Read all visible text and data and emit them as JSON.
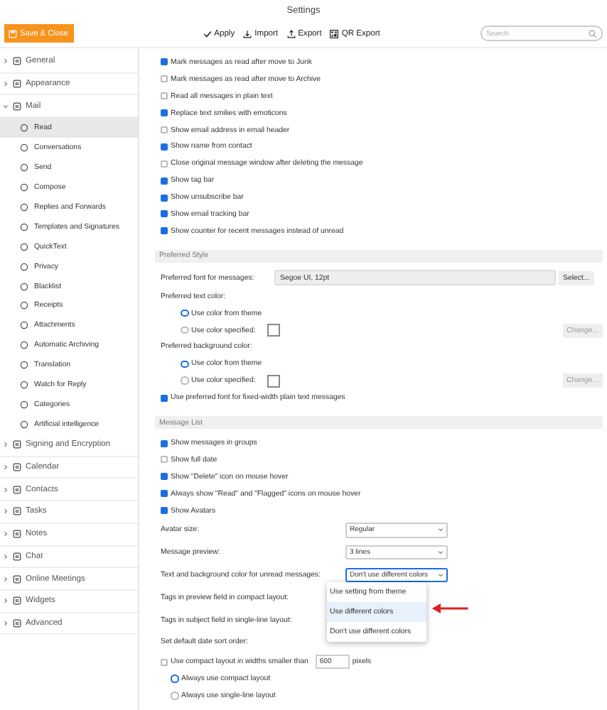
{
  "window": {
    "title": "Settings"
  },
  "toolbar": {
    "save": "Save & Close",
    "actions": [
      {
        "label": "Apply",
        "kind": "check"
      },
      {
        "label": "Import",
        "kind": "import"
      },
      {
        "label": "Export",
        "kind": "export"
      },
      {
        "label": "QR Export",
        "kind": "qr"
      }
    ],
    "search": {
      "placeholder": "Search"
    }
  },
  "sidebar": {
    "items": [
      {
        "label": "General",
        "expanded": false
      },
      {
        "label": "Appearance",
        "expanded": false
      },
      {
        "label": "Mail",
        "expanded": true,
        "children": [
          {
            "label": "Read",
            "selected": true
          },
          {
            "label": "Conversations",
            "selected": false
          },
          {
            "label": "Send",
            "selected": false
          },
          {
            "label": "Compose",
            "selected": false
          },
          {
            "label": "Replies and Forwards",
            "selected": false
          },
          {
            "label": "Templates and Signatures",
            "selected": false
          },
          {
            "label": "QuickText",
            "selected": false
          },
          {
            "label": "Privacy",
            "selected": false
          },
          {
            "label": "Blacklist",
            "selected": false
          },
          {
            "label": "Receipts",
            "selected": false
          },
          {
            "label": "Attachments",
            "selected": false
          },
          {
            "label": "Automatic Archiving",
            "selected": false
          },
          {
            "label": "Translation",
            "selected": false
          },
          {
            "label": "Watch for Reply",
            "selected": false
          },
          {
            "label": "Categories",
            "selected": false
          },
          {
            "label": "Artificial intelligence",
            "selected": false
          }
        ]
      },
      {
        "label": "Signing and Encryption",
        "expanded": false
      },
      {
        "label": "Calendar",
        "expanded": false
      },
      {
        "label": "Contacts",
        "expanded": false
      },
      {
        "label": "Tasks",
        "expanded": false
      },
      {
        "label": "Notes",
        "expanded": false
      },
      {
        "label": "Chat",
        "expanded": false
      },
      {
        "label": "Online Meetings",
        "expanded": false
      },
      {
        "label": "Widgets",
        "expanded": false
      },
      {
        "label": "Advanced",
        "expanded": false
      }
    ]
  },
  "read_options": [
    {
      "label": "Mark messages as read after move to Junk",
      "checked": true
    },
    {
      "label": "Mark messages as read after move to Archive",
      "checked": false
    },
    {
      "label": "Read all messages in plain text",
      "checked": false
    },
    {
      "label": "Replace text smilies with emoticons",
      "checked": true
    },
    {
      "label": "Show email address in email header",
      "checked": false
    },
    {
      "label": "Show name from contact",
      "checked": true
    },
    {
      "label": "Close original message window after deleting the message",
      "checked": false
    },
    {
      "label": "Show tag bar",
      "checked": true
    },
    {
      "label": "Show unsubscribe bar",
      "checked": true
    },
    {
      "label": "Show email tracking bar",
      "checked": true
    },
    {
      "label": "Show counter for recent messages instead of unread",
      "checked": true
    }
  ],
  "preferred_style": {
    "title": "Preferred Style",
    "font_label": "Preferred font for messages:",
    "font_value": "Segoe UI, 12pt",
    "select_button": "Select...",
    "text_color": {
      "label": "Preferred text color:",
      "options": [
        {
          "label": "Use color from theme",
          "selected": true
        },
        {
          "label": "Use color specified:",
          "selected": false
        }
      ],
      "change_button": "Change..."
    },
    "background_color": {
      "label": "Preferred background color:",
      "options": [
        {
          "label": "Use color from theme",
          "selected": true
        },
        {
          "label": "Use color specified:",
          "selected": false
        }
      ],
      "change_button": "Change..."
    },
    "fixed_width": {
      "label": "Use preferred font for fixed-width plain text messages",
      "checked": true
    }
  },
  "message_list": {
    "title": "Message List",
    "options": [
      {
        "label": "Show messages in groups",
        "checked": true
      },
      {
        "label": "Show full date",
        "checked": false
      },
      {
        "label": "Show \"Delete\" icon on mouse hover",
        "checked": true
      },
      {
        "label": "Always show \"Read\" and \"Flagged\" icons on mouse hover",
        "checked": true
      },
      {
        "label": "Show Avatars",
        "checked": true
      }
    ],
    "selects": [
      {
        "label": "Avatar size:",
        "value": "Regular",
        "open": false
      },
      {
        "label": "Message preview:",
        "value": "3 lines",
        "open": false
      },
      {
        "label": "Text and background color for unread messages:",
        "value": "Don't use different colors",
        "open": true
      },
      {
        "label": "Tags in preview field in compact layout:"
      },
      {
        "label": "Tags in subject field in single-line layout:"
      },
      {
        "label": "Set default date sort order:"
      }
    ],
    "dropdown_options": [
      {
        "label": "Use setting from theme",
        "selected": false
      },
      {
        "label": "Use different colors",
        "selected": true
      },
      {
        "label": "Don't use different colors",
        "selected": false
      }
    ],
    "compact": {
      "label": "Use compact layout in widths smaller than",
      "checked": false,
      "value": "600",
      "unit": "pixels"
    },
    "layout_options": [
      {
        "label": "Always use compact layout",
        "selected": true
      },
      {
        "label": "Always use single-line layout",
        "selected": false
      }
    ]
  }
}
